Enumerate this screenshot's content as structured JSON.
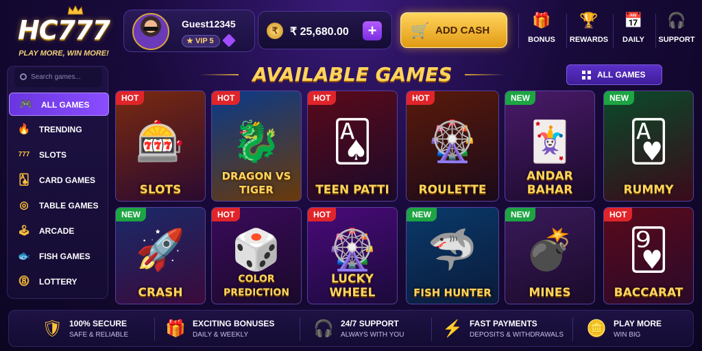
{
  "brand": {
    "name": "HC777",
    "tagline": "PLAY MORE, WIN MORE!"
  },
  "user": {
    "name": "Guest12345",
    "vip": "VIP 5"
  },
  "wallet": {
    "currency_symbol": "₹",
    "balance": "₹ 25,680.00",
    "add_cash_label": "ADD CASH"
  },
  "header_nav": [
    {
      "label": "BONUS",
      "icon": "gift-icon"
    },
    {
      "label": "REWARDS",
      "icon": "trophy-icon"
    },
    {
      "label": "DAILY",
      "icon": "calendar-icon"
    },
    {
      "label": "SUPPORT",
      "icon": "headset-icon"
    }
  ],
  "sidebar": {
    "search_placeholder": "Search games...",
    "items": [
      {
        "label": "ALL GAMES",
        "icon": "gamepad-icon",
        "active": true
      },
      {
        "label": "TRENDING",
        "icon": "fire-icon"
      },
      {
        "label": "SLOTS",
        "icon": "slot-777-icon"
      },
      {
        "label": "CARD GAMES",
        "icon": "cards-icon"
      },
      {
        "label": "TABLE GAMES",
        "icon": "chip-icon"
      },
      {
        "label": "ARCADE",
        "icon": "joystick-icon"
      },
      {
        "label": "FISH GAMES",
        "icon": "fish-icon"
      },
      {
        "label": "LOTTERY",
        "icon": "lottery-ball-icon"
      }
    ]
  },
  "main": {
    "title": "AVAILABLE GAMES",
    "all_games_button": "ALL GAMES",
    "games": [
      {
        "label": "SLOTS",
        "badge": "HOT",
        "icon": "slot-machine-icon"
      },
      {
        "label": "DRAGON VS TIGER",
        "badge": "HOT",
        "icon": "dragon-tiger-icon"
      },
      {
        "label": "TEEN PATTI",
        "badge": "HOT",
        "icon": "cards-chips-icon"
      },
      {
        "label": "ROULETTE",
        "badge": "HOT",
        "icon": "roulette-wheel-icon"
      },
      {
        "label": "ANDAR BAHAR",
        "badge": "NEW",
        "icon": "cards-icon"
      },
      {
        "label": "RUMMY",
        "badge": "NEW",
        "icon": "cards-chips-icon"
      },
      {
        "label": "CRASH",
        "badge": "NEW",
        "icon": "rocket-icon"
      },
      {
        "label": "COLOR PREDICTION",
        "badge": "HOT",
        "icon": "dice-icon"
      },
      {
        "label": "LUCKY WHEEL",
        "badge": "HOT",
        "icon": "prize-wheel-icon"
      },
      {
        "label": "FISH HUNTER",
        "badge": "NEW",
        "icon": "shark-icon"
      },
      {
        "label": "MINES",
        "badge": "NEW",
        "icon": "bomb-icon"
      },
      {
        "label": "BACCARAT",
        "badge": "HOT",
        "icon": "cards-chips-icon"
      }
    ]
  },
  "footer": [
    {
      "title": "100% SECURE",
      "subtitle": "SAFE & RELIABLE",
      "icon": "shield-icon"
    },
    {
      "title": "EXCITING BONUSES",
      "subtitle": "DAILY & WEEKLY",
      "icon": "gift-icon"
    },
    {
      "title": "24/7 SUPPORT",
      "subtitle": "ALWAYS WITH YOU",
      "icon": "headset-icon"
    },
    {
      "title": "FAST PAYMENTS",
      "subtitle": "DEPOSITS & WITHDRAWALS",
      "icon": "lightning-icon"
    },
    {
      "title": "PLAY MORE",
      "subtitle": "WIN BIG",
      "icon": "coins-icon"
    }
  ],
  "colors": {
    "accent_gold": "#ffd45c",
    "accent_purple": "#7b3fe4",
    "hot": "#e0252a",
    "new": "#1da443",
    "background": "#180a3a"
  }
}
